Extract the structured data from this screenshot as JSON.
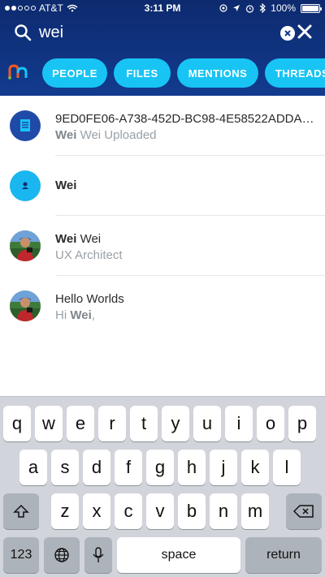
{
  "status_bar": {
    "carrier": "AT&T",
    "time": "3:11 PM",
    "battery": "100%"
  },
  "search": {
    "query": "wei"
  },
  "filters": [
    {
      "label": "PEOPLE"
    },
    {
      "label": "FILES"
    },
    {
      "label": "MENTIONS"
    },
    {
      "label": "THREADS"
    }
  ],
  "results": [
    {
      "type": "file",
      "title": "9ED0FE06-A738-452D-BC98-4E58522ADDAF--1...",
      "subtitle_bold": "Wei",
      "subtitle_rest": " Wei Uploaded"
    },
    {
      "type": "space",
      "title_bold": "Wei"
    },
    {
      "type": "person",
      "title_bold": "Wei",
      "title_rest": " Wei",
      "subtitle": "UX Architect"
    },
    {
      "type": "message",
      "title": "Hello Worlds",
      "subtitle_prefix": "Hi ",
      "subtitle_bold": "Wei",
      "subtitle_suffix": ","
    }
  ],
  "keyboard": {
    "row1": [
      "q",
      "w",
      "e",
      "r",
      "t",
      "y",
      "u",
      "i",
      "o",
      "p"
    ],
    "row2": [
      "a",
      "s",
      "d",
      "f",
      "g",
      "h",
      "j",
      "k",
      "l"
    ],
    "row3": [
      "z",
      "x",
      "c",
      "v",
      "b",
      "n",
      "m"
    ],
    "numbers_label": "123",
    "space_label": "space",
    "return_label": "return"
  },
  "colors": {
    "header_top": "#0d2a6e",
    "header_bottom": "#123b8f",
    "chip": "#18c4f4",
    "file_icon_bg": "#1f4aa8",
    "space_icon_bg": "#19b6f0"
  }
}
